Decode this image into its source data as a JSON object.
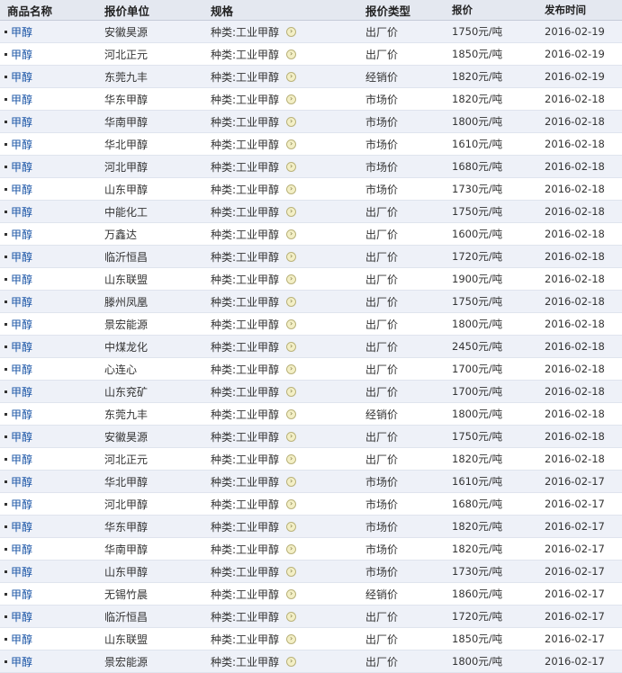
{
  "headers": [
    "商品名称",
    "报价单位",
    "规格",
    "报价类型",
    "报价",
    "发布时间"
  ],
  "rows": [
    [
      "甲醇",
      "安徽昊源",
      "种类:工业甲醇",
      "出厂价",
      "1750元/吨",
      "2016-02-19"
    ],
    [
      "甲醇",
      "河北正元",
      "种类:工业甲醇",
      "出厂价",
      "1850元/吨",
      "2016-02-19"
    ],
    [
      "甲醇",
      "东莞九丰",
      "种类:工业甲醇",
      "经销价",
      "1820元/吨",
      "2016-02-19"
    ],
    [
      "甲醇",
      "华东甲醇",
      "种类:工业甲醇",
      "市场价",
      "1820元/吨",
      "2016-02-18"
    ],
    [
      "甲醇",
      "华南甲醇",
      "种类:工业甲醇",
      "市场价",
      "1800元/吨",
      "2016-02-18"
    ],
    [
      "甲醇",
      "华北甲醇",
      "种类:工业甲醇",
      "市场价",
      "1610元/吨",
      "2016-02-18"
    ],
    [
      "甲醇",
      "河北甲醇",
      "种类:工业甲醇",
      "市场价",
      "1680元/吨",
      "2016-02-18"
    ],
    [
      "甲醇",
      "山东甲醇",
      "种类:工业甲醇",
      "市场价",
      "1730元/吨",
      "2016-02-18"
    ],
    [
      "甲醇",
      "中能化工",
      "种类:工业甲醇",
      "出厂价",
      "1750元/吨",
      "2016-02-18"
    ],
    [
      "甲醇",
      "万鑫达",
      "种类:工业甲醇",
      "出厂价",
      "1600元/吨",
      "2016-02-18"
    ],
    [
      "甲醇",
      "临沂恒昌",
      "种类:工业甲醇",
      "出厂价",
      "1720元/吨",
      "2016-02-18"
    ],
    [
      "甲醇",
      "山东联盟",
      "种类:工业甲醇",
      "出厂价",
      "1900元/吨",
      "2016-02-18"
    ],
    [
      "甲醇",
      "滕州凤凰",
      "种类:工业甲醇",
      "出厂价",
      "1750元/吨",
      "2016-02-18"
    ],
    [
      "甲醇",
      "景宏能源",
      "种类:工业甲醇",
      "出厂价",
      "1800元/吨",
      "2016-02-18"
    ],
    [
      "甲醇",
      "中煤龙化",
      "种类:工业甲醇",
      "出厂价",
      "2450元/吨",
      "2016-02-18"
    ],
    [
      "甲醇",
      "心连心",
      "种类:工业甲醇",
      "出厂价",
      "1700元/吨",
      "2016-02-18"
    ],
    [
      "甲醇",
      "山东兖矿",
      "种类:工业甲醇",
      "出厂价",
      "1700元/吨",
      "2016-02-18"
    ],
    [
      "甲醇",
      "东莞九丰",
      "种类:工业甲醇",
      "经销价",
      "1800元/吨",
      "2016-02-18"
    ],
    [
      "甲醇",
      "安徽昊源",
      "种类:工业甲醇",
      "出厂价",
      "1750元/吨",
      "2016-02-18"
    ],
    [
      "甲醇",
      "河北正元",
      "种类:工业甲醇",
      "出厂价",
      "1820元/吨",
      "2016-02-18"
    ],
    [
      "甲醇",
      "华北甲醇",
      "种类:工业甲醇",
      "市场价",
      "1610元/吨",
      "2016-02-17"
    ],
    [
      "甲醇",
      "河北甲醇",
      "种类:工业甲醇",
      "市场价",
      "1680元/吨",
      "2016-02-17"
    ],
    [
      "甲醇",
      "华东甲醇",
      "种类:工业甲醇",
      "市场价",
      "1820元/吨",
      "2016-02-17"
    ],
    [
      "甲醇",
      "华南甲醇",
      "种类:工业甲醇",
      "市场价",
      "1820元/吨",
      "2016-02-17"
    ],
    [
      "甲醇",
      "山东甲醇",
      "种类:工业甲醇",
      "市场价",
      "1730元/吨",
      "2016-02-17"
    ],
    [
      "甲醇",
      "无锡竹晨",
      "种类:工业甲醇",
      "经销价",
      "1860元/吨",
      "2016-02-17"
    ],
    [
      "甲醇",
      "临沂恒昌",
      "种类:工业甲醇",
      "出厂价",
      "1720元/吨",
      "2016-02-17"
    ],
    [
      "甲醇",
      "山东联盟",
      "种类:工业甲醇",
      "出厂价",
      "1850元/吨",
      "2016-02-17"
    ],
    [
      "甲醇",
      "景宏能源",
      "种类:工业甲醇",
      "出厂价",
      "1800元/吨",
      "2016-02-17"
    ]
  ],
  "colors": {
    "header_bg": "#e4e8f0",
    "row_alt_bg": "#eef1f8",
    "link": "#1a55a6"
  },
  "icons": {
    "bullet": "square-bullet-icon",
    "spec_arrow": "arrow-circle-icon"
  }
}
